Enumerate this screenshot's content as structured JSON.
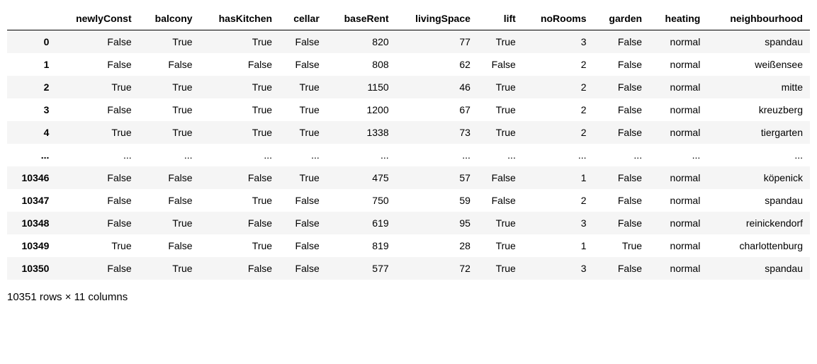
{
  "chart_data": {
    "type": "table",
    "columns": [
      "newlyConst",
      "balcony",
      "hasKitchen",
      "cellar",
      "baseRent",
      "livingSpace",
      "lift",
      "noRooms",
      "garden",
      "heating",
      "neighbourhood"
    ],
    "index": [
      "0",
      "1",
      "2",
      "3",
      "4",
      "...",
      "10346",
      "10347",
      "10348",
      "10349",
      "10350"
    ],
    "rows": [
      [
        "False",
        "True",
        "True",
        "False",
        "820",
        "77",
        "True",
        "3",
        "False",
        "normal",
        "spandau"
      ],
      [
        "False",
        "False",
        "False",
        "False",
        "808",
        "62",
        "False",
        "2",
        "False",
        "normal",
        "weißensee"
      ],
      [
        "True",
        "True",
        "True",
        "True",
        "1150",
        "46",
        "True",
        "2",
        "False",
        "normal",
        "mitte"
      ],
      [
        "False",
        "True",
        "True",
        "True",
        "1200",
        "67",
        "True",
        "2",
        "False",
        "normal",
        "kreuzberg"
      ],
      [
        "True",
        "True",
        "True",
        "True",
        "1338",
        "73",
        "True",
        "2",
        "False",
        "normal",
        "tiergarten"
      ],
      [
        "...",
        "...",
        "...",
        "...",
        "...",
        "...",
        "...",
        "...",
        "...",
        "...",
        "..."
      ],
      [
        "False",
        "False",
        "False",
        "True",
        "475",
        "57",
        "False",
        "1",
        "False",
        "normal",
        "köpenick"
      ],
      [
        "False",
        "False",
        "True",
        "False",
        "750",
        "59",
        "False",
        "2",
        "False",
        "normal",
        "spandau"
      ],
      [
        "False",
        "True",
        "False",
        "False",
        "619",
        "95",
        "True",
        "3",
        "False",
        "normal",
        "reinickendorf"
      ],
      [
        "True",
        "False",
        "True",
        "False",
        "819",
        "28",
        "True",
        "1",
        "True",
        "normal",
        "charlottenburg"
      ],
      [
        "False",
        "True",
        "False",
        "False",
        "577",
        "72",
        "True",
        "3",
        "False",
        "normal",
        "spandau"
      ]
    ],
    "footer": "10351 rows × 11 columns"
  }
}
